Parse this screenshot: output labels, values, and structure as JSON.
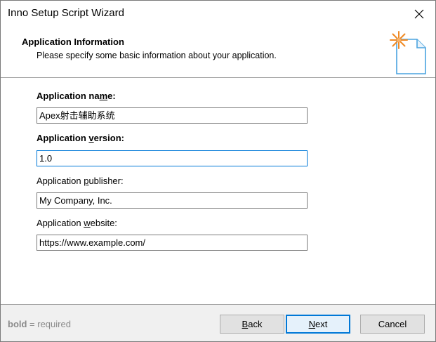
{
  "window": {
    "title": "Inno Setup Script Wizard"
  },
  "header": {
    "title": "Application Information",
    "subtitle": "Please specify some basic information about your application."
  },
  "fields": {
    "name": {
      "label_pre": "Application na",
      "label_key": "m",
      "label_post": "e:",
      "value": "Apex射击辅助系统"
    },
    "version": {
      "label_pre": "Application ",
      "label_key": "v",
      "label_post": "ersion:",
      "value": "1.0"
    },
    "publisher": {
      "label_pre": "Application ",
      "label_key": "p",
      "label_post": "ublisher:",
      "value": "My Company, Inc."
    },
    "website": {
      "label_pre": "Application ",
      "label_key": "w",
      "label_post": "ebsite:",
      "value": "https://www.example.com/"
    }
  },
  "footer": {
    "hint_bold": "bold",
    "hint_rest": " = required",
    "back": {
      "key": "B",
      "rest": "ack"
    },
    "next": {
      "key": "N",
      "rest": "ext"
    },
    "cancel": "Cancel"
  },
  "colors": {
    "focus": "#0078d7",
    "icon_star": "#f08a24",
    "icon_doc": "#4aa3df"
  }
}
